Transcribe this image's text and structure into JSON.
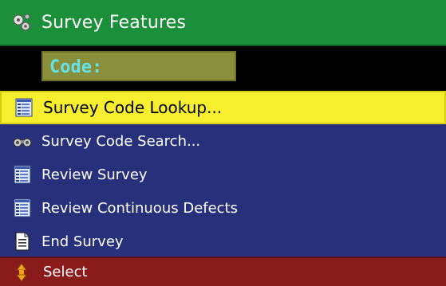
{
  "window": {
    "title": "Survey Features",
    "title_icon": "gears-icon"
  },
  "code_input": {
    "label": "Code:",
    "value": ""
  },
  "menu": {
    "items": [
      {
        "label": "Survey Code Lookup...",
        "icon": "list-icon",
        "selected": true
      },
      {
        "label": "Survey Code Search...",
        "icon": "binoculars-icon",
        "selected": false
      },
      {
        "label": "Review Survey",
        "icon": "list-icon",
        "selected": false
      },
      {
        "label": "Review Continuous Defects",
        "icon": "list-icon",
        "selected": false
      },
      {
        "label": "End Survey",
        "icon": "document-icon",
        "selected": false
      }
    ]
  },
  "status": {
    "hint_icon": "up-down-arrows-icon",
    "hint_label": "Select"
  },
  "colors": {
    "title_bg": "#1c8f3a",
    "menu_bg": "#27307b",
    "selected_bg": "#f6ee2e",
    "status_bg": "#8a1b1b",
    "code_text": "#63e2e8"
  }
}
